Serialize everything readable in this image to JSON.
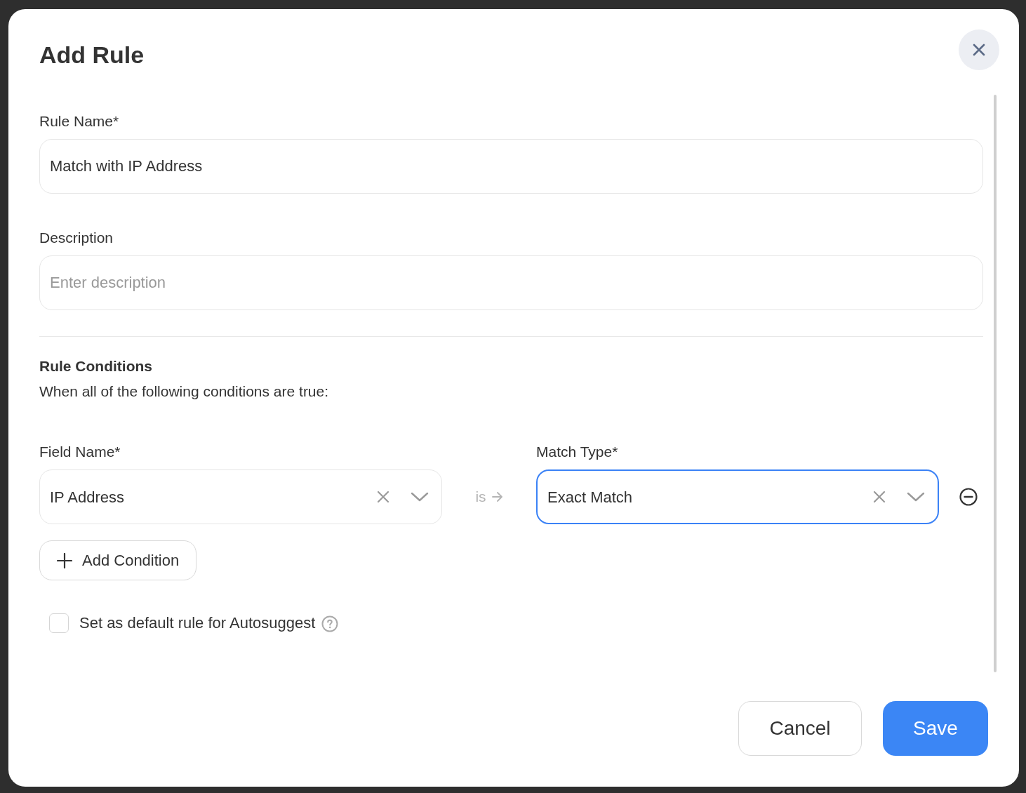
{
  "dialog": {
    "title": "Add Rule"
  },
  "fields": [
    {
      "label": "Rule Name*",
      "value": "Match with IP Address"
    },
    {
      "label": "Description",
      "placeholder": "Enter description"
    }
  ],
  "conditions": {
    "heading": "Rule Conditions",
    "description": "When all of the following conditions are true:",
    "rows": [
      {
        "field": {
          "label": "Field Name*",
          "value": "IP Address",
          "focused": false
        },
        "operator": "is",
        "match": {
          "label": "Match Type*",
          "value": "Exact Match",
          "focused": true
        }
      }
    ]
  },
  "add_condition": "Add Condition",
  "default_rule": {
    "label": "Set as default rule for Autosuggest",
    "checked": false
  },
  "buttons": [
    {
      "label": "Cancel",
      "kind": "secondary"
    },
    {
      "label": "Save",
      "kind": "primary"
    }
  ]
}
